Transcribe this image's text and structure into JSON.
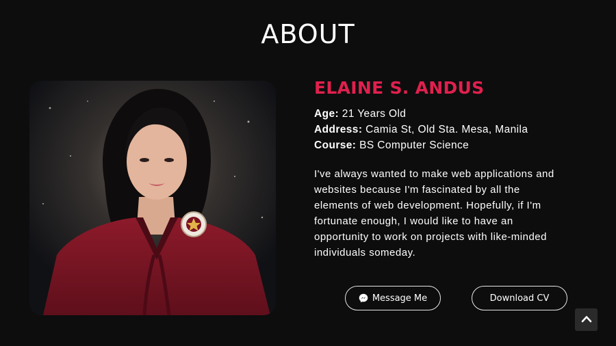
{
  "section": {
    "title": "ABOUT"
  },
  "profile": {
    "photo_alt": "graduation portrait",
    "name": "ELAINE S. ANDUS",
    "facts": [
      {
        "label": "Age:",
        "value": "21 Years Old"
      },
      {
        "label": "Address:",
        "value": "Camia St, Old Sta. Mesa, Manila"
      },
      {
        "label": "Course:",
        "value": "BS Computer Science"
      }
    ],
    "bio_lines": [
      "I've always wanted to make web applications and",
      "websites because I'm fascinated by all the",
      "elements of web development. Hopefully, if I'm",
      "fortunate enough, I would like to have an",
      "opportunity to work on projects with like-minded",
      "individuals someday."
    ]
  },
  "actions": {
    "message_label": "Message Me",
    "message_icon": "messenger-icon",
    "cv_label": "Download CV"
  },
  "scroll_top": {
    "icon": "chevron-up-icon"
  },
  "colors": {
    "background": "#0d0d0e",
    "accent": "#e0204d",
    "text": "#ffffff",
    "gown": "#7a1422"
  }
}
